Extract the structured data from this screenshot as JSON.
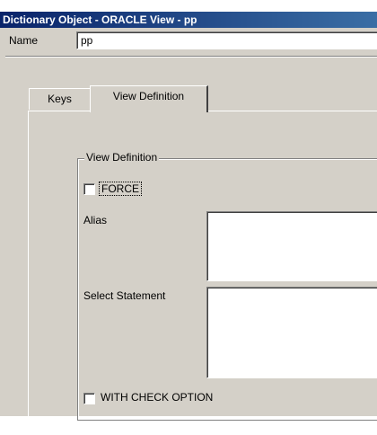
{
  "window": {
    "title": "Dictionary Object - ORACLE View - pp"
  },
  "form": {
    "name_label": "Name",
    "name_value": "pp"
  },
  "tabs": [
    {
      "label": "Keys",
      "active": false
    },
    {
      "label": "View Definition",
      "active": true
    }
  ],
  "view_definition": {
    "group_title": "View Definition",
    "force_label": "FORCE",
    "force_checked": false,
    "alias_label": "Alias",
    "alias_value": "",
    "select_label": "Select Statement",
    "select_value": "",
    "check_option_label": "WITH CHECK OPTION",
    "check_option_checked": false
  },
  "colors": {
    "face": "#d4d0c8",
    "title_start": "#0a246a",
    "title_end": "#3a6ea5"
  }
}
